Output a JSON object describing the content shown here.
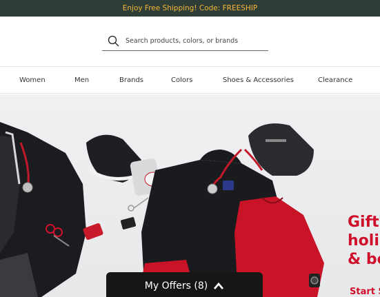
{
  "promo": {
    "text": "Enjoy Free Shipping! Code: FREESHIP"
  },
  "search": {
    "placeholder": "Search products, colors, or brands",
    "value": ""
  },
  "nav": {
    "items": [
      {
        "label": "Women"
      },
      {
        "label": "Men"
      },
      {
        "label": "Brands"
      },
      {
        "label": "Colors"
      },
      {
        "label": "Shoes & Accessories"
      },
      {
        "label": "Clearance"
      }
    ]
  },
  "hero": {
    "headline_line1": "Gift",
    "headline_line2": "holi",
    "headline_line3": "& be",
    "subtext": "Start S"
  },
  "offers": {
    "label": "My Offers (8)",
    "icon": "chevron-up-icon"
  },
  "colors": {
    "promo_bg": "#2e3e36",
    "promo_text": "#f5b63a",
    "accent_red": "#d0102b"
  }
}
